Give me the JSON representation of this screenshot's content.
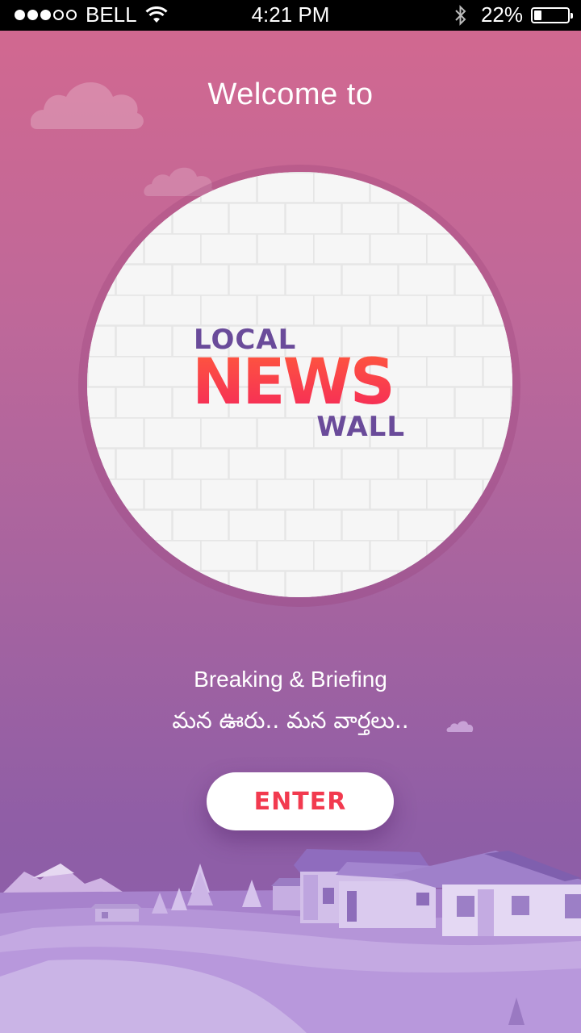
{
  "status_bar": {
    "carrier": "BELL",
    "time": "4:21 PM",
    "battery": "22%",
    "battery_level": 0.22,
    "signal_bars_filled": 3,
    "signal_bars_total": 5
  },
  "welcome": {
    "title": "Welcome to"
  },
  "logo": {
    "line1": "LOCAL",
    "line2": "NEWS",
    "line3": "WALL"
  },
  "tagline": {
    "english": "Breaking & Briefing",
    "telugu": "మన ఊరు.. మన వార్తలు.."
  },
  "actions": {
    "enter_label": "ENTER"
  },
  "colors": {
    "gradient_top": "#d3688f",
    "gradient_bottom": "#8a5fab",
    "logo_purple": "#6a4b9a",
    "logo_red": "#f4275b",
    "button_text": "#f23a4f"
  }
}
